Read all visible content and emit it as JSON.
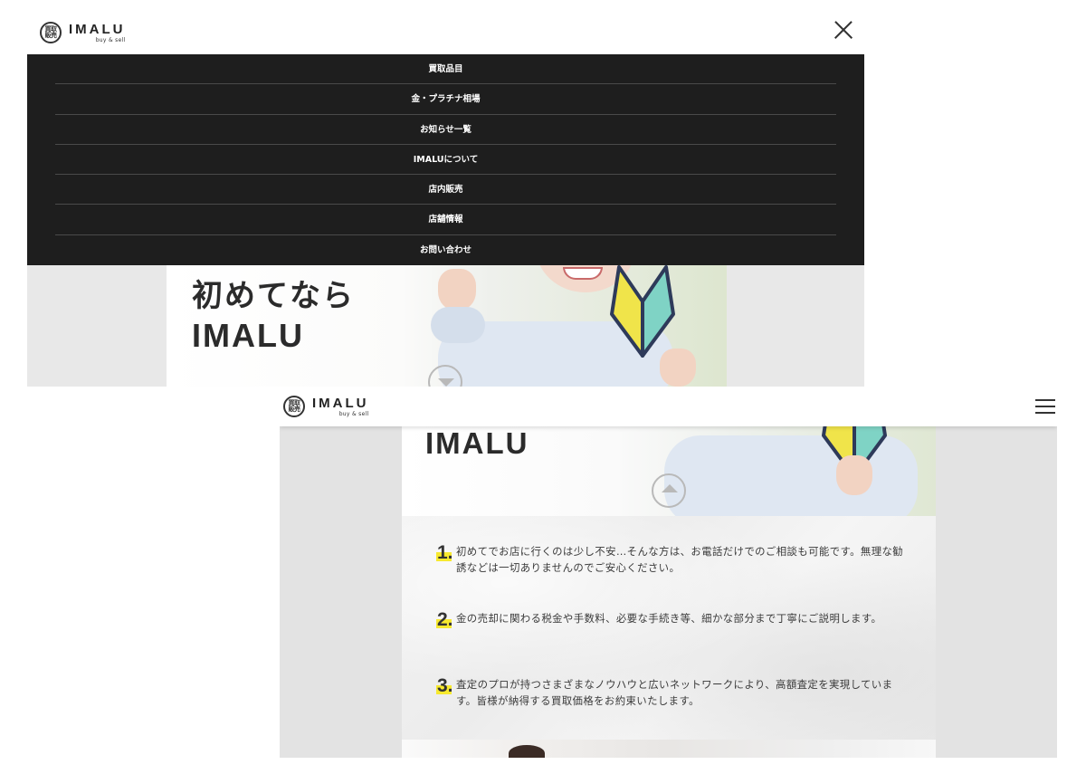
{
  "brand": {
    "name": "IMALU",
    "tagline": "buy & sell",
    "mark_top": "買取",
    "mark_bottom": "販売"
  },
  "menu": {
    "items": [
      {
        "label": "買取品目"
      },
      {
        "label": "金・プラチナ相場"
      },
      {
        "label": "お知らせ一覧"
      },
      {
        "label": "IMALUについて"
      },
      {
        "label": "店内販売"
      },
      {
        "label": "店舗情報"
      },
      {
        "label": "お問い合わせ"
      }
    ]
  },
  "hero": {
    "line1": "初めてなら",
    "line2": "IMALU"
  },
  "points": [
    {
      "number": "1.",
      "text": "初めてでお店に行くのは少し不安…そんな方は、お電話だけでのご相談も可能です。無理な勧誘などは一切ありませんのでご安心ください。"
    },
    {
      "number": "2.",
      "text": "金の売却に関わる税金や手数料、必要な手続き等、細かな部分まで丁寧にご説明します。"
    },
    {
      "number": "3.",
      "text": "査定のプロが持つさまざまなノウハウと広いネットワークにより、高額査定を実現しています。皆様が納得する買取価格をお約束いたします。"
    }
  ],
  "colors": {
    "menu_bg": "#1e1e1e",
    "highlight": "#f7e92f",
    "page_bg": "#e3e3e3"
  },
  "icons": {
    "close": "close-icon",
    "menu": "hamburger-icon",
    "scroll_down": "chevron-down-icon",
    "scroll_up": "chevron-up-icon"
  }
}
